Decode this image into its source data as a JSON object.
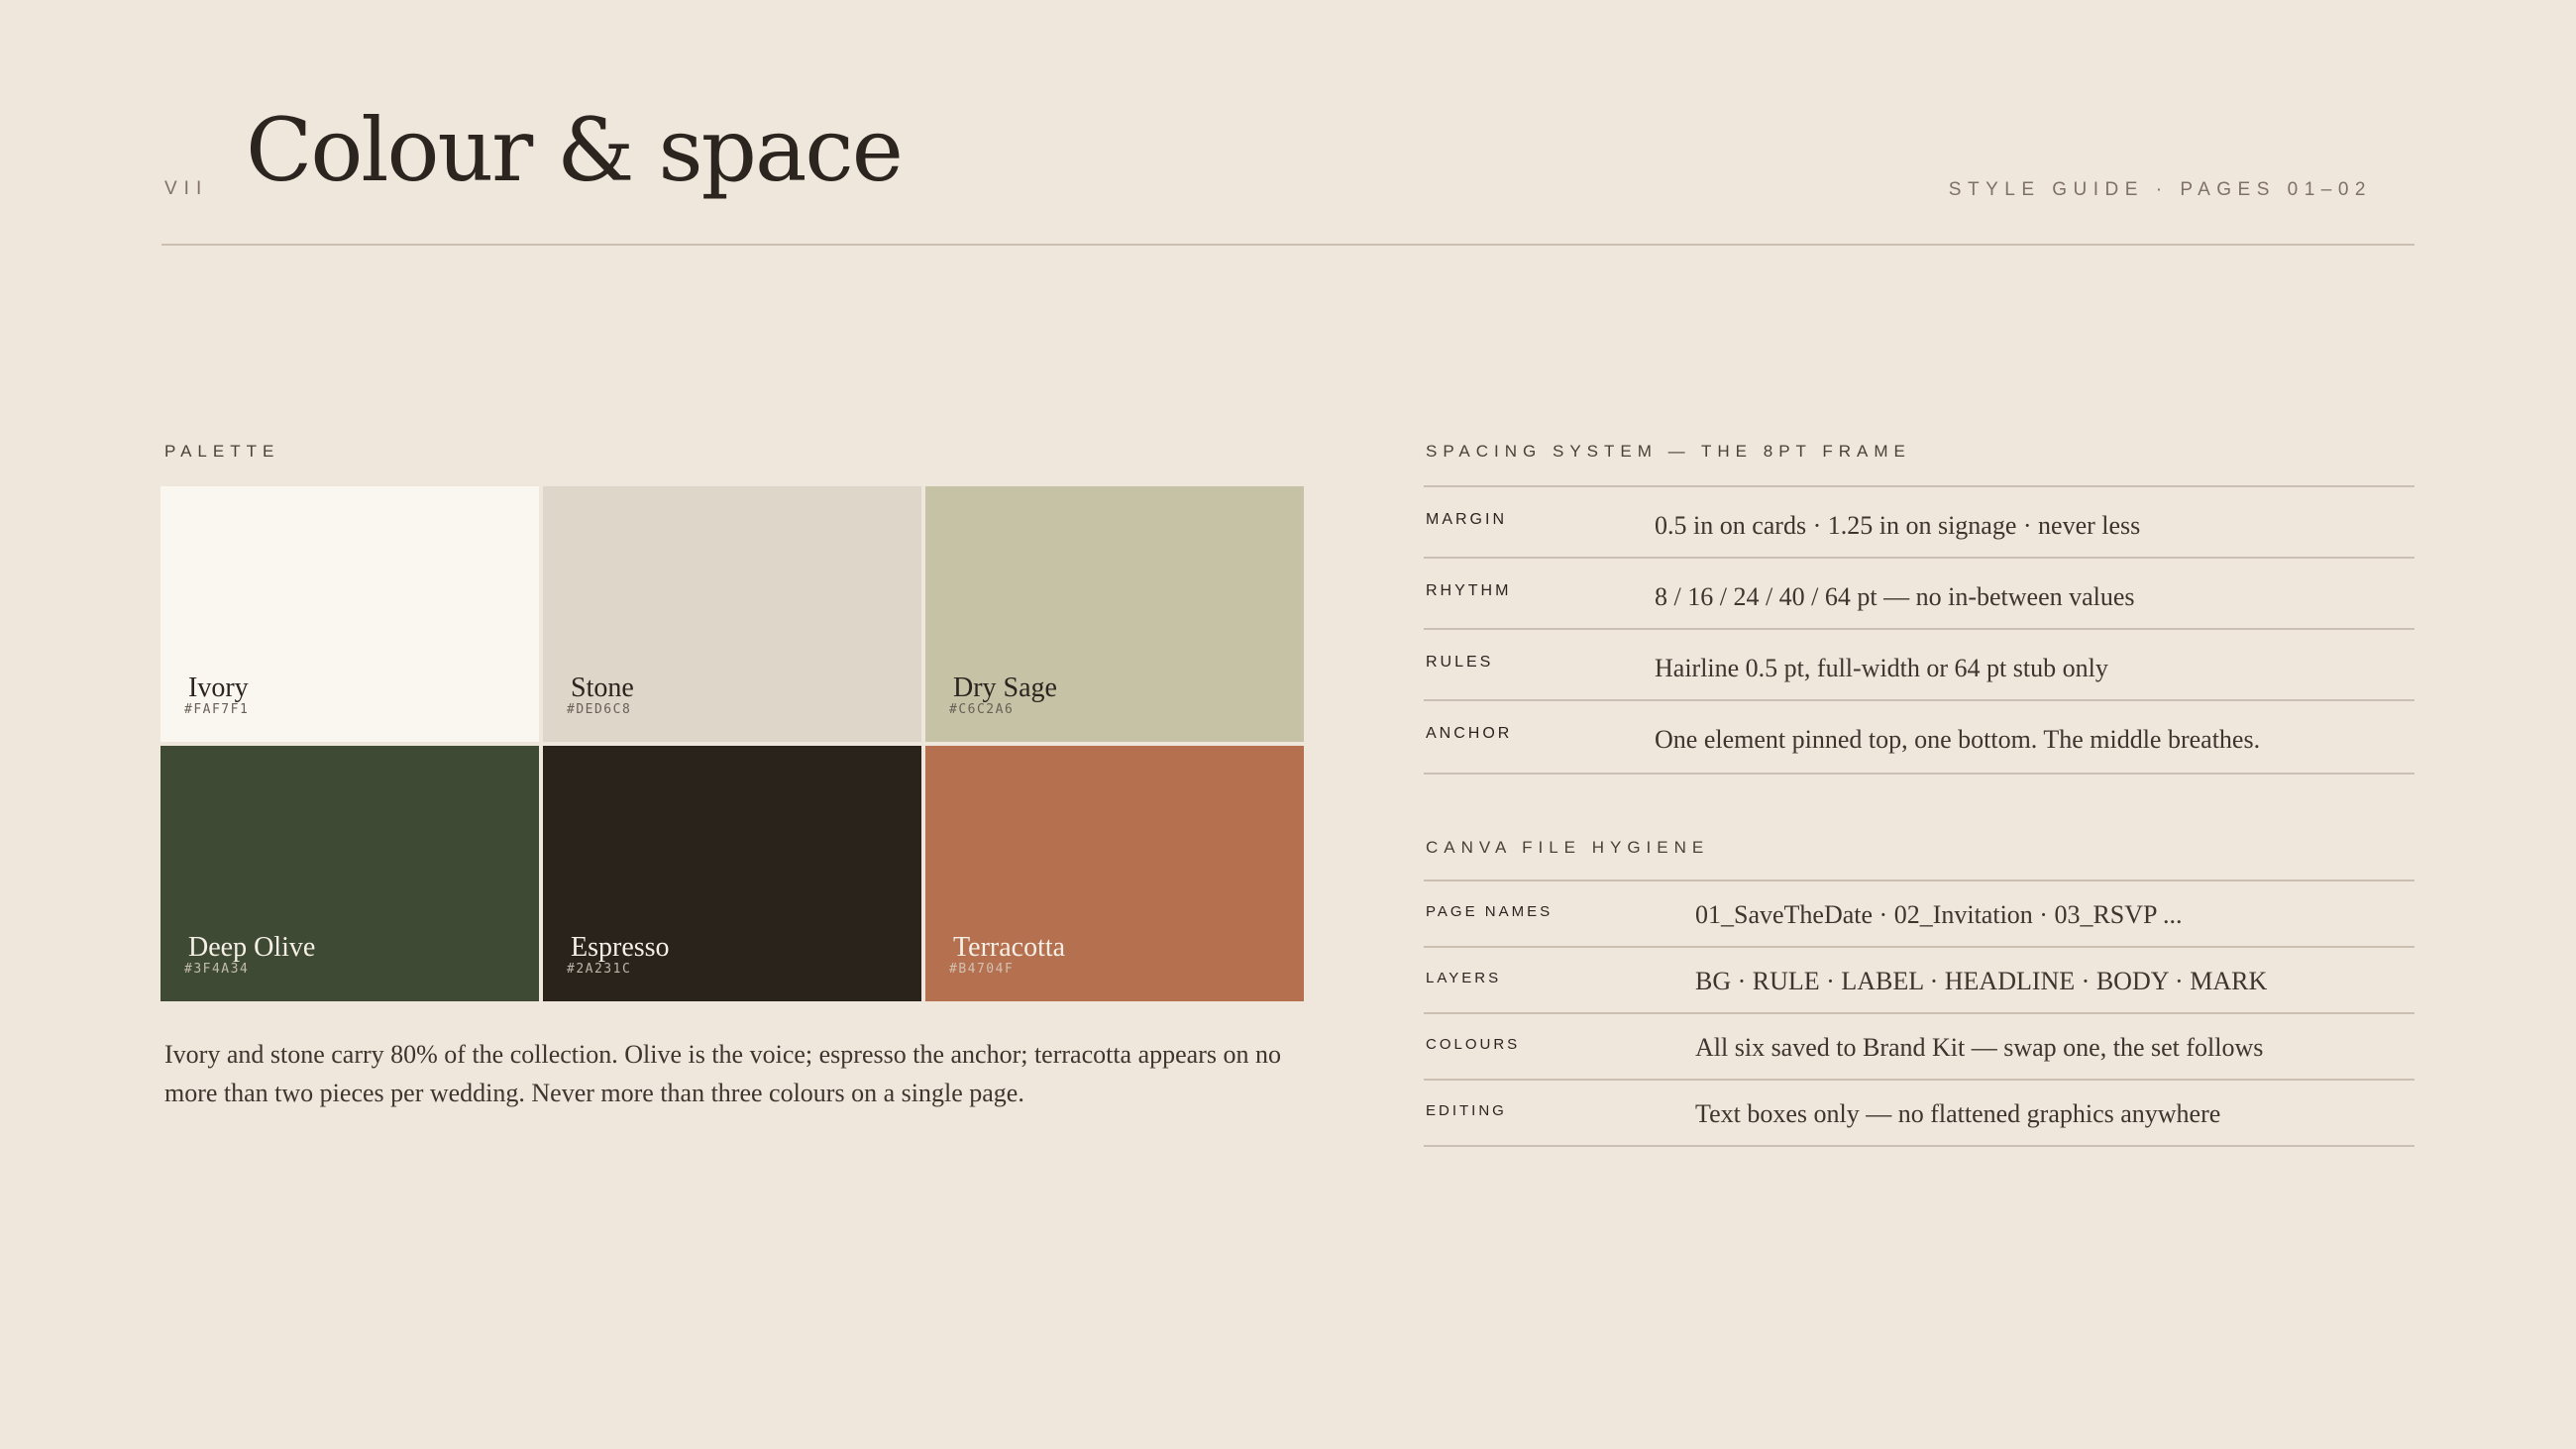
{
  "header": {
    "section_number": "VII",
    "title": "Colour & space",
    "meta": "STYLE GUIDE · PAGES 01–02"
  },
  "palette": {
    "label": "PALETTE",
    "swatches": [
      {
        "name": "Ivory",
        "hex": "#FAF7F1",
        "color": "#FAF7F1"
      },
      {
        "name": "Stone",
        "hex": "#DED6C8",
        "color": "#DED6C8"
      },
      {
        "name": "Dry Sage",
        "hex": "#C6C2A6",
        "color": "#C6C2A6"
      },
      {
        "name": "Deep Olive",
        "hex": "#3F4A34",
        "color": "#3F4A34"
      },
      {
        "name": "Espresso",
        "hex": "#2A231C",
        "color": "#2A231C"
      },
      {
        "name": "Terracotta",
        "hex": "#B4704F",
        "color": "#B4704F"
      }
    ],
    "note": "Ivory and stone carry 80% of the collection. Olive is the voice; espresso the anchor; terracotta appears on no more than two pieces per wedding. Never more than three colours on a single page."
  },
  "spacing": {
    "label": "SPACING SYSTEM — THE 8PT FRAME",
    "rows": [
      {
        "key": "MARGIN",
        "value": "0.5 in on cards · 1.25 in on signage · never less"
      },
      {
        "key": "RHYTHM",
        "value": "8 / 16 / 24 / 40 / 64 pt — no in-between values"
      },
      {
        "key": "RULES",
        "value": "Hairline 0.5 pt, full-width or 64 pt stub only"
      },
      {
        "key": "ANCHOR",
        "value": "One element pinned top, one bottom. The middle breathes."
      }
    ]
  },
  "hygiene": {
    "label": "CANVA FILE HYGIENE",
    "rows": [
      {
        "key": "PAGE NAMES",
        "value": "01_SaveTheDate · 02_Invitation · 03_RSVP ..."
      },
      {
        "key": "LAYERS",
        "value": "BG · RULE · LABEL · HEADLINE · BODY · MARK"
      },
      {
        "key": "COLOURS",
        "value": "All six saved to Brand Kit — swap one, the set follows"
      },
      {
        "key": "EDITING",
        "value": "Text boxes only — no flattened graphics anywhere"
      }
    ]
  },
  "colors": {
    "background": "#EFE6DC",
    "ink": "#2C241F",
    "rule": "#CBBFB2"
  }
}
